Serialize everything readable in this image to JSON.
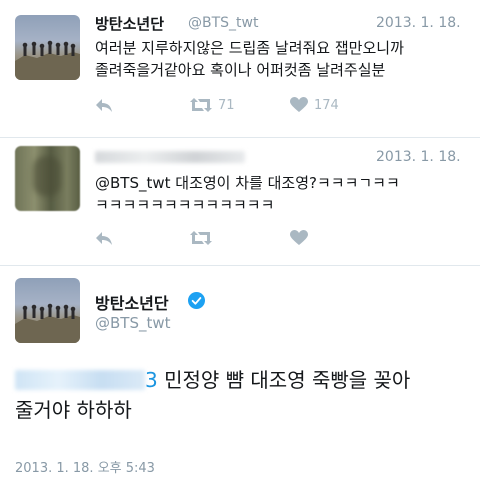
{
  "tweets": [
    {
      "name": "방탄소년단",
      "handle": "@BTS_twt",
      "date": "2013. 1. 18.",
      "lines": [
        "여러분 지루하지않은 드립좀 날려줘요 잽만오니까",
        "졸려죽을거같아요 혹이나 어퍼컷좀 날려주실분"
      ],
      "retweets": "71",
      "likes": "174"
    },
    {
      "date": "2013. 1. 18.",
      "lines": [
        "@BTS_twt 대조영이 차를 대조영?ㅋㅋㅋㄱㅋㅋ",
        "ㅋㅋㅋㅋㅋㅋㅋㅋㅋㅋㅋㅋㅋ"
      ]
    }
  ],
  "detail": {
    "name": "방탄소년단",
    "handle": "@BTS_twt",
    "mention_tail": "3",
    "line1": " 민정양 뺨 대조영 죽빵을 꽂아",
    "line2": "줄거야 하하하",
    "timestamp": "2013. 1. 18. 오후 5:43"
  },
  "icons": {
    "reply": "reply-icon",
    "retweet": "retweet-icon",
    "like": "heart-icon",
    "verified": "verified-badge-icon"
  },
  "colors": {
    "text": "#14171a",
    "secondary": "#8899a6",
    "icon": "#aab8c2",
    "link": "#1b95e0",
    "verified": "#1da1f2"
  }
}
